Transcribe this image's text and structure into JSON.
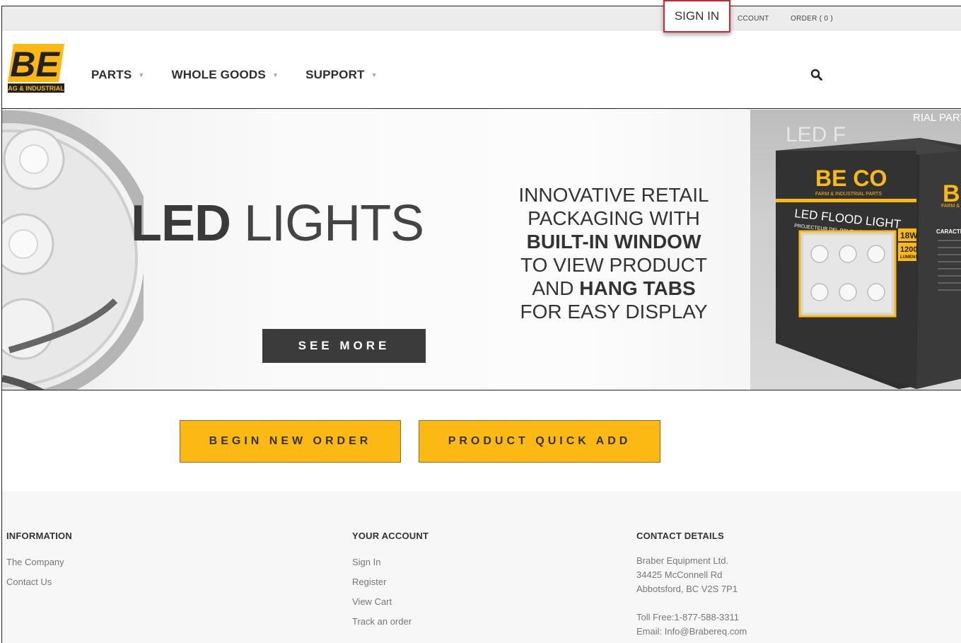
{
  "topbar": {
    "sign_in": "SIGN IN",
    "account": "CCOUNT",
    "order": "ORDER ( 0 )"
  },
  "header": {
    "logo_text": "BE",
    "logo_sub": "AG & INDUSTRIAL",
    "nav": [
      {
        "label": "PARTS"
      },
      {
        "label": "WHOLE GOODS"
      },
      {
        "label": "SUPPORT"
      }
    ],
    "search_icon": "search-icon"
  },
  "hero": {
    "title_bold": "LED",
    "title_light": "LIGHTS",
    "see_more": "SEE MORE",
    "copy": {
      "l1": "INNOVATIVE RETAIL",
      "l2": "PACKAGING WITH",
      "l3": "BUILT-IN WINDOW",
      "l4": "TO VIEW PRODUCT",
      "l5a": "AND ",
      "l5b": "HANG TABS",
      "l6": "FOR EASY DISPLAY"
    },
    "box": {
      "brand": "BE CO",
      "brand_sub": "FARM & INDUSTRIAL PARTS",
      "product": "LED FLOOD LIGHT",
      "product_fr": "PROJECTEUR DEL POUR VÉHICULE",
      "watts": "18W",
      "lumens": "1200",
      "lumens_unit": "LUMENS",
      "corner_text": "RIAL PARTS",
      "side_brand": "B",
      "side_sub": "FARM &",
      "side_head": "CARACTI"
    }
  },
  "cta": {
    "begin": "BEGIN NEW ORDER",
    "quick": "PRODUCT QUICK ADD"
  },
  "footer": {
    "information": {
      "heading": "INFORMATION",
      "links": [
        "The Company",
        "Contact Us"
      ]
    },
    "account": {
      "heading": "YOUR ACCOUNT",
      "links": [
        "Sign In",
        "Register",
        "View Cart",
        "Track an order"
      ]
    },
    "contact": {
      "heading": "CONTACT DETAILS",
      "company": "Braber Equipment Ltd.",
      "street": "34425 McConnell Rd",
      "city": "Abbotsford, BC V2S 7P1",
      "toll": "Toll Free:1-877-588-3311",
      "email": "Email: Info@Brabereq.com"
    }
  },
  "colors": {
    "accent_yellow": "#fdb913",
    "dark_button": "#3b3b3b",
    "highlight_red": "#c9292f"
  }
}
